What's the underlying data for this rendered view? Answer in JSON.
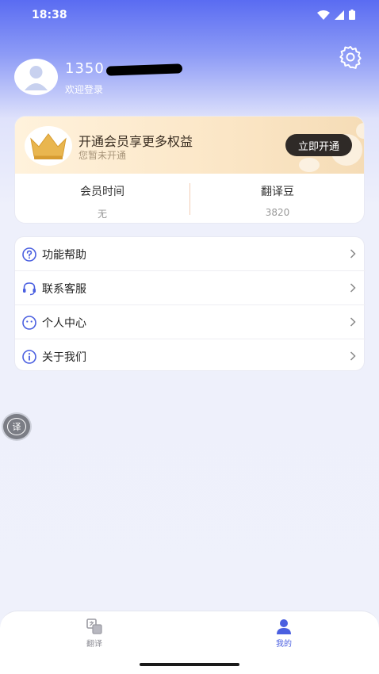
{
  "status_bar": {
    "time": "18:38"
  },
  "profile": {
    "username": "1350",
    "login_hint": "欢迎登录"
  },
  "vip": {
    "title": "开通会员享更多权益",
    "subtitle": "您暂未开通",
    "open_button": "立即开通",
    "stats": [
      {
        "label": "会员时间",
        "value": "无"
      },
      {
        "label": "翻译豆",
        "value": "3820"
      }
    ]
  },
  "menu": {
    "items": [
      {
        "label": "功能帮助",
        "icon": "question-circle-icon"
      },
      {
        "label": "联系客服",
        "icon": "headset-icon"
      },
      {
        "label": "个人中心",
        "icon": "smiley-face-icon"
      },
      {
        "label": "关于我们",
        "icon": "info-circle-icon"
      }
    ]
  },
  "floating_button": {
    "label": "译"
  },
  "bottom_nav": {
    "tabs": [
      {
        "label": "翻译",
        "active": false
      },
      {
        "label": "我的",
        "active": true
      }
    ]
  },
  "colors": {
    "accent": "#4a5fe0",
    "header_gradient_top": "#5a6cf2",
    "vip_button": "#2f2a27",
    "vip_gold": "#e9b64f"
  }
}
